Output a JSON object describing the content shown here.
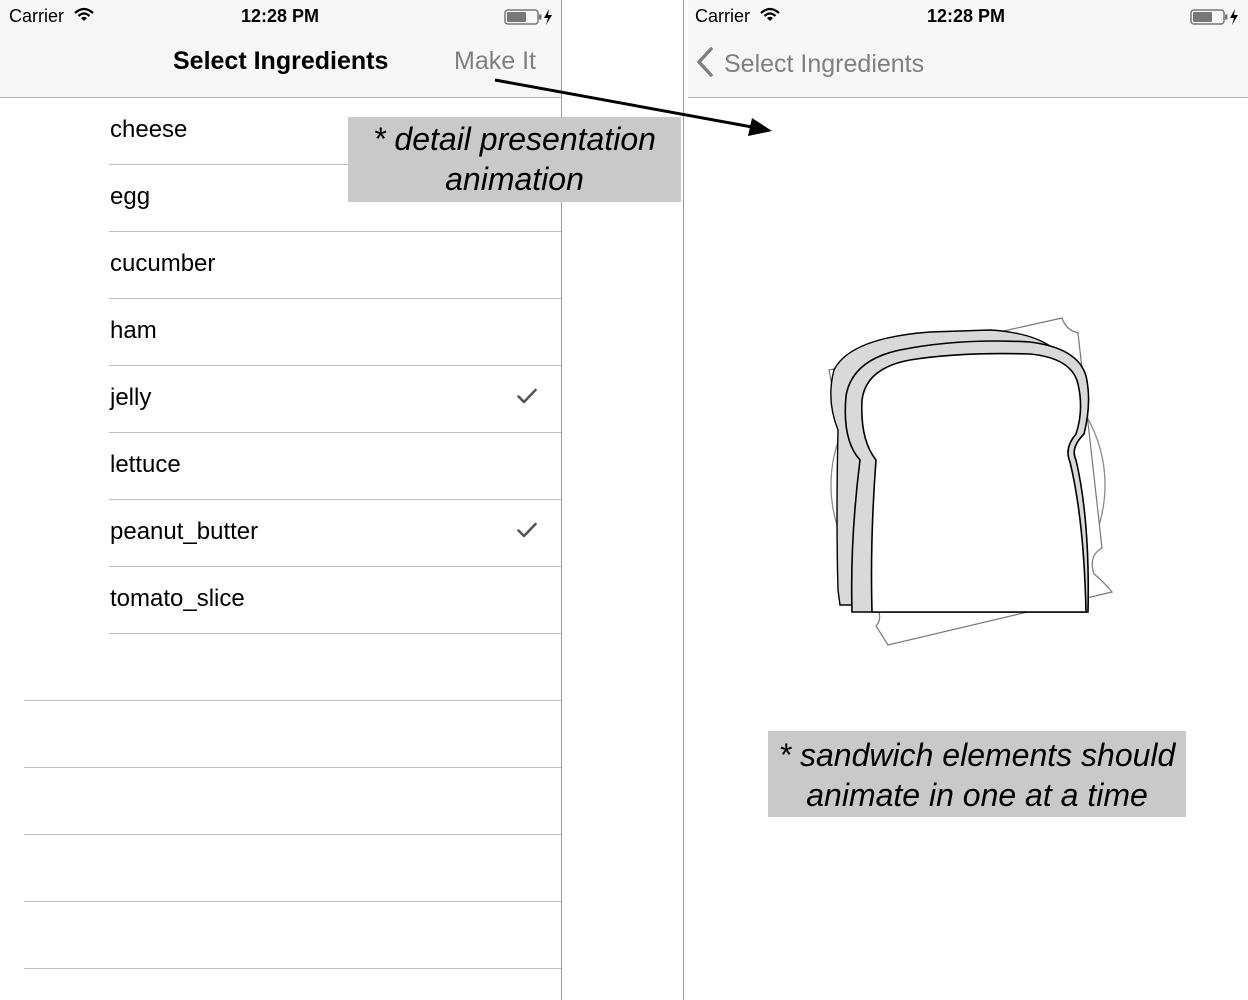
{
  "status_bar": {
    "carrier": "Carrier",
    "time": "12:28 PM"
  },
  "list_screen": {
    "title": "Select Ingredients",
    "action_label": "Make It",
    "ingredients": [
      {
        "label": "cheese",
        "checked": false
      },
      {
        "label": "egg",
        "checked": false
      },
      {
        "label": "cucumber",
        "checked": false
      },
      {
        "label": "ham",
        "checked": false
      },
      {
        "label": "jelly",
        "checked": true
      },
      {
        "label": "lettuce",
        "checked": false
      },
      {
        "label": "peanut_butter",
        "checked": true
      },
      {
        "label": "tomato_slice",
        "checked": false
      }
    ]
  },
  "detail_screen": {
    "back_label": "Select Ingredients"
  },
  "annotations": {
    "detail_presentation": "* detail presentation animation",
    "sandwich_animation": "* sandwich elements should animate in one at a time"
  },
  "colors": {
    "bar_background": "#f7f7f7",
    "tint_gray": "#7f7f7f",
    "callout_background": "#c9c9c9",
    "separator": "#bdbdbd"
  }
}
